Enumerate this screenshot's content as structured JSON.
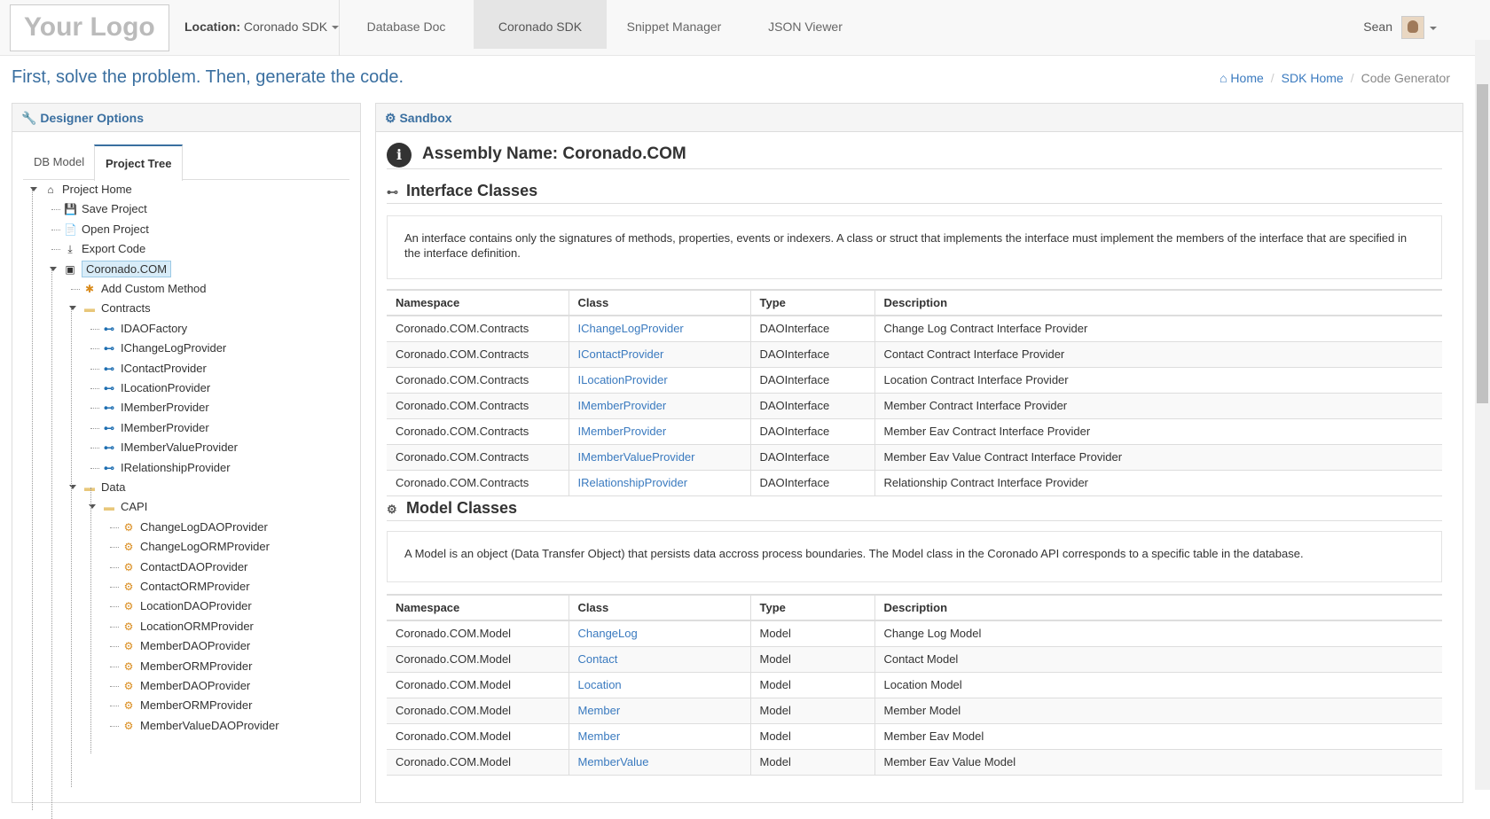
{
  "navbar": {
    "logo": "Your Logo",
    "location_label": "Location:",
    "location_value": "Coronado SDK",
    "tabs": [
      "Database Doc",
      "Coronado SDK",
      "Snippet Manager",
      "JSON Viewer"
    ],
    "active_tab": "Coronado SDK",
    "user": "Sean"
  },
  "headline": "First, solve the problem. Then, generate the code.",
  "breadcrumb": [
    "Home",
    "SDK Home",
    "Code Generator"
  ],
  "designer": {
    "title": "Designer Options",
    "tabs": [
      "DB Model",
      "Project Tree"
    ],
    "active_tab": "Project Tree"
  },
  "tree": {
    "root": "Project Home",
    "actions": [
      "Save Project",
      "Open Project",
      "Export Code"
    ],
    "assembly": "Coronado.COM",
    "add_method": "Add Custom Method",
    "contracts": "Contracts",
    "contract_items": [
      "IDAOFactory",
      "IChangeLogProvider",
      "IContactProvider",
      "ILocationProvider",
      "IMemberProvider",
      "IMemberProvider",
      "IMemberValueProvider",
      "IRelationshipProvider"
    ],
    "data": "Data",
    "capi": "CAPI",
    "capi_items": [
      "ChangeLogDAOProvider",
      "ChangeLogORMProvider",
      "ContactDAOProvider",
      "ContactORMProvider",
      "LocationDAOProvider",
      "LocationORMProvider",
      "MemberDAOProvider",
      "MemberORMProvider",
      "MemberDAOProvider",
      "MemberORMProvider",
      "MemberValueDAOProvider"
    ]
  },
  "sandbox": {
    "title": "Sandbox",
    "assembly_label": "Assembly Name: Coronado.COM",
    "interface_title": "Interface Classes",
    "interface_desc": "An interface contains only the signatures of methods, properties, events or indexers. A class or struct that implements the interface must implement the members of the interface that are specified in the interface definition.",
    "columns": [
      "Namespace",
      "Class",
      "Type",
      "Description"
    ],
    "interface_rows": [
      [
        "Coronado.COM.Contracts",
        "IChangeLogProvider",
        "DAOInterface",
        "Change Log Contract Interface Provider"
      ],
      [
        "Coronado.COM.Contracts",
        "IContactProvider",
        "DAOInterface",
        "Contact Contract Interface Provider"
      ],
      [
        "Coronado.COM.Contracts",
        "ILocationProvider",
        "DAOInterface",
        "Location Contract Interface Provider"
      ],
      [
        "Coronado.COM.Contracts",
        "IMemberProvider",
        "DAOInterface",
        "Member Contract Interface Provider"
      ],
      [
        "Coronado.COM.Contracts",
        "IMemberProvider",
        "DAOInterface",
        "Member Eav Contract Interface Provider"
      ],
      [
        "Coronado.COM.Contracts",
        "IMemberValueProvider",
        "DAOInterface",
        "Member Eav Value Contract Interface Provider"
      ],
      [
        "Coronado.COM.Contracts",
        "IRelationshipProvider",
        "DAOInterface",
        "Relationship Contract Interface Provider"
      ]
    ],
    "model_title": "Model Classes",
    "model_desc": "A Model is an object (Data Transfer Object) that persists data accross process boundaries. The Model class in the Coronado API corresponds to a specific table in the database.",
    "model_rows": [
      [
        "Coronado.COM.Model",
        "ChangeLog",
        "Model",
        "Change Log Model"
      ],
      [
        "Coronado.COM.Model",
        "Contact",
        "Model",
        "Contact Model"
      ],
      [
        "Coronado.COM.Model",
        "Location",
        "Model",
        "Location Model"
      ],
      [
        "Coronado.COM.Model",
        "Member",
        "Model",
        "Member Model"
      ],
      [
        "Coronado.COM.Model",
        "Member",
        "Model",
        "Member Eav Model"
      ],
      [
        "Coronado.COM.Model",
        "MemberValue",
        "Model",
        "Member Eav Value Model"
      ]
    ]
  }
}
